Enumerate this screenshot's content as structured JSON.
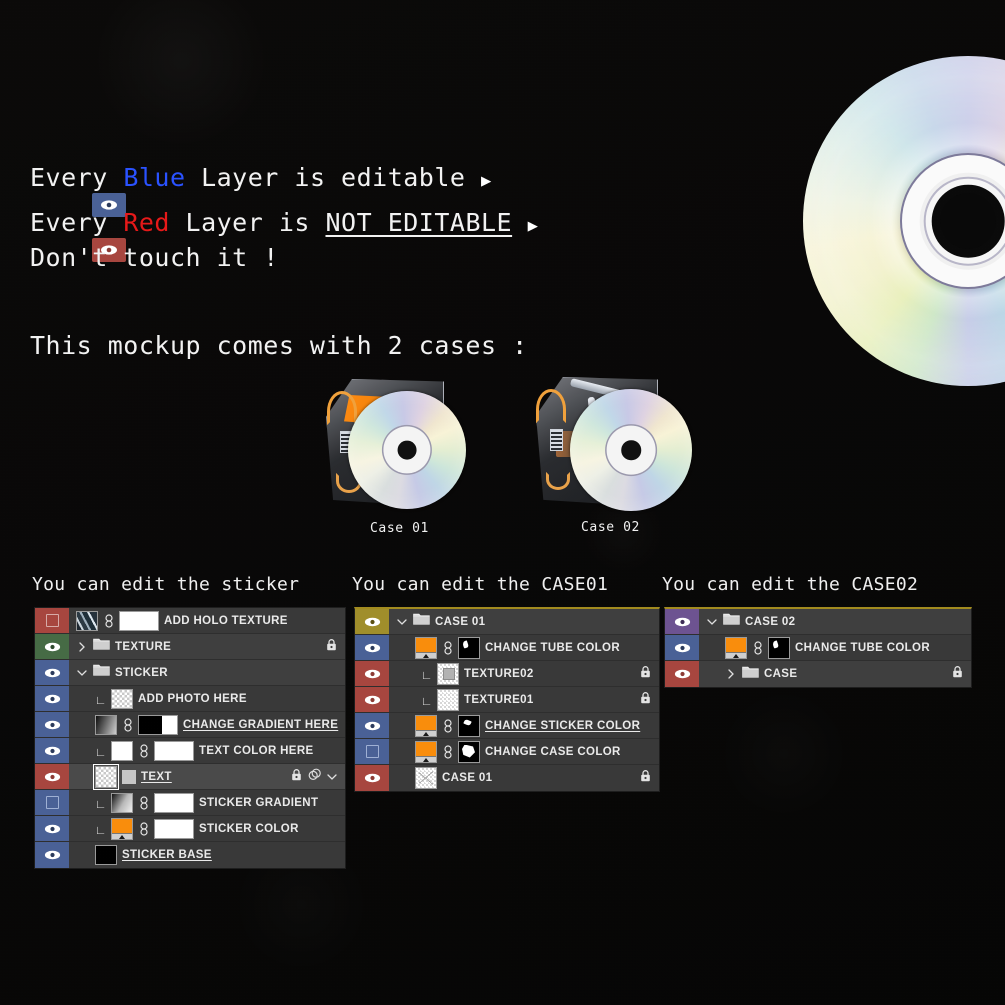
{
  "headline": {
    "line1_pre": "Every ",
    "line1_kw": "Blue",
    "line1_post": " Layer is editable ",
    "line1_arrow": "▶",
    "line2_pre": "Every ",
    "line2_kw": "Red",
    "line2_mid": " Layer is ",
    "line2_em": "NOT EDITABLE",
    "line2_arrow": "▶",
    "line3": "Don't touch it !",
    "line4": "This mockup comes with 2 cases :",
    "blue_chip_color": "#4a6196",
    "red_chip_color": "#a7463f",
    "blue_word_color": "#2a52ff",
    "red_word_color": "#e61919"
  },
  "cases": {
    "case01_label": "Case 01",
    "case02_label": "Case 02"
  },
  "panels": [
    {
      "caption": "You can edit the sticker",
      "rows": [
        {
          "strip": "red",
          "visible": false,
          "indent": 0,
          "type": "layer",
          "thumbs": [
            "holo"
          ],
          "link": true,
          "mask": "white",
          "name": "ADD HOLO TEXTURE",
          "underline": false,
          "locked": false
        },
        {
          "strip": "green",
          "visible": true,
          "indent": 0,
          "type": "group-collapsed",
          "thumbs": [],
          "link": false,
          "mask": null,
          "name": "TEXTURE",
          "underline": false,
          "locked": true
        },
        {
          "strip": "blue",
          "visible": true,
          "indent": 0,
          "type": "group-open",
          "thumbs": [],
          "link": false,
          "mask": null,
          "name": "STICKER",
          "underline": false,
          "locked": false
        },
        {
          "strip": "blue",
          "visible": true,
          "indent": 1,
          "type": "clipped",
          "thumbs": [
            "checker"
          ],
          "link": false,
          "mask": null,
          "name": "ADD PHOTO HERE",
          "underline": false,
          "locked": false
        },
        {
          "strip": "blue",
          "visible": true,
          "indent": 1,
          "type": "layer",
          "thumbs": [
            "grad-bw"
          ],
          "link": true,
          "mask": "blackwhite",
          "name": "CHANGE GRADIENT HERE",
          "underline": true,
          "locked": false
        },
        {
          "strip": "blue",
          "visible": true,
          "indent": 1,
          "type": "clipped",
          "thumbs": [
            "white"
          ],
          "link": true,
          "mask": "white",
          "name": "TEXT COLOR HERE",
          "underline": false,
          "locked": false
        },
        {
          "strip": "red",
          "visible": true,
          "indent": 1,
          "type": "text",
          "thumbs": [
            "textthumb"
          ],
          "link": false,
          "mask": null,
          "name": "TEXT",
          "underline": true,
          "locked": true,
          "fx": true,
          "chevron": true,
          "selected": true
        },
        {
          "strip": "blue",
          "visible": false,
          "indent": 1,
          "type": "clipped",
          "thumbs": [
            "grad-gray"
          ],
          "link": true,
          "mask": "white",
          "name": "STICKER GRADIENT",
          "underline": false,
          "locked": false
        },
        {
          "strip": "blue",
          "visible": true,
          "indent": 1,
          "type": "clipped",
          "thumbs": [
            "orange"
          ],
          "link": true,
          "mask": "white",
          "name": "STICKER COLOR",
          "underline": false,
          "locked": false
        },
        {
          "strip": "blue",
          "visible": true,
          "indent": 1,
          "type": "layer",
          "thumbs": [
            "black"
          ],
          "link": false,
          "mask": null,
          "name": "STICKER BASE",
          "underline": true,
          "locked": false
        }
      ]
    },
    {
      "caption": "You can edit the CASE01",
      "rows": [
        {
          "strip": "olive",
          "visible": true,
          "indent": 0,
          "type": "group-open",
          "thumbs": [],
          "link": false,
          "mask": null,
          "name": "CASE 01",
          "underline": false,
          "locked": false
        },
        {
          "strip": "blue",
          "visible": true,
          "indent": 1,
          "type": "layer",
          "thumbs": [
            "orange"
          ],
          "link": true,
          "mask": "mask-tube",
          "name": "CHANGE TUBE COLOR",
          "underline": false,
          "locked": false
        },
        {
          "strip": "red",
          "visible": true,
          "indent": 2,
          "type": "clipped",
          "thumbs": [
            "tex02"
          ],
          "link": false,
          "mask": null,
          "name": "TEXTURE02",
          "underline": false,
          "locked": true
        },
        {
          "strip": "red",
          "visible": true,
          "indent": 2,
          "type": "clipped",
          "thumbs": [
            "checker-fine"
          ],
          "link": false,
          "mask": null,
          "name": "TEXTURE01",
          "underline": false,
          "locked": true
        },
        {
          "strip": "blue",
          "visible": true,
          "indent": 1,
          "type": "layer",
          "thumbs": [
            "orange"
          ],
          "link": true,
          "mask": "mask-sticker",
          "name": "CHANGE STICKER COLOR",
          "underline": true,
          "locked": false
        },
        {
          "strip": "blue",
          "visible": false,
          "indent": 1,
          "type": "layer",
          "thumbs": [
            "orange"
          ],
          "link": true,
          "mask": "mask-case",
          "name": "CHANGE CASE COLOR",
          "underline": false,
          "locked": false
        },
        {
          "strip": "red",
          "visible": true,
          "indent": 1,
          "type": "layer",
          "thumbs": [
            "case01thumb"
          ],
          "link": false,
          "mask": null,
          "name": "CASE 01",
          "underline": false,
          "locked": true
        }
      ]
    },
    {
      "caption": "You can edit the CASE02",
      "rows": [
        {
          "strip": "purple",
          "visible": true,
          "indent": 0,
          "type": "group-open",
          "thumbs": [],
          "link": false,
          "mask": null,
          "name": "CASE 02",
          "underline": false,
          "locked": false
        },
        {
          "strip": "blue",
          "visible": true,
          "indent": 1,
          "type": "layer",
          "thumbs": [
            "orange"
          ],
          "link": true,
          "mask": "mask-tube",
          "name": "CHANGE TUBE COLOR",
          "underline": false,
          "locked": false
        },
        {
          "strip": "red",
          "visible": true,
          "indent": 1,
          "type": "group-collapsed",
          "thumbs": [],
          "link": false,
          "mask": null,
          "name": "CASE",
          "underline": false,
          "locked": true
        }
      ]
    }
  ],
  "icons": {
    "eye": "eye-icon",
    "lock": "lock-icon",
    "fx": "effects-icon",
    "chevron_down": "chevron-down-icon",
    "chevron_right": "chevron-right-icon",
    "folder": "folder-icon",
    "link": "link-icon",
    "clip": "clipping-mask-icon"
  },
  "colors": {
    "panel_bg": "#393939",
    "row_selected": "#4a4a4a",
    "strip_blue": "#4a6196",
    "strip_red": "#a7463f",
    "strip_green": "#466b45",
    "strip_olive": "#a08e2b",
    "strip_purple": "#6d5391",
    "accent_orange": "#f98d0c",
    "panel_top_accent": "#a28b1f"
  }
}
